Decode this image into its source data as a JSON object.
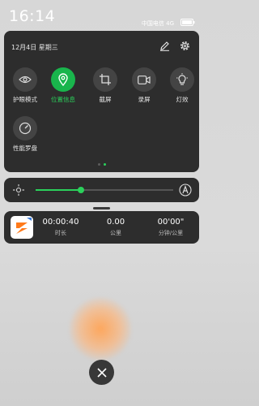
{
  "status_bar": {
    "time": "16:14",
    "carrier": "中国电信 4G",
    "battery_icon": "battery-icon"
  },
  "quick_panel": {
    "date": "12月4日 星期三",
    "edit_icon": "pencil-icon",
    "settings_icon": "gear-icon",
    "tiles": [
      {
        "label": "护眼模式",
        "icon": "eye-icon",
        "active": false
      },
      {
        "label": "位置信息",
        "icon": "location-pin-icon",
        "active": true
      },
      {
        "label": "截屏",
        "icon": "crop-icon",
        "active": false
      },
      {
        "label": "录屏",
        "icon": "video-camera-icon",
        "active": false
      },
      {
        "label": "灯效",
        "icon": "light-bulb-icon",
        "active": false
      },
      {
        "label": "性能罗盘",
        "icon": "gauge-icon",
        "active": false
      }
    ],
    "page_count": 2,
    "current_page": 1
  },
  "brightness": {
    "level_percent": 33,
    "brightness_icon": "brightness-sun-icon",
    "auto_icon": "auto-brightness-icon"
  },
  "notification": {
    "app_icon": "sport-app-icon",
    "stats": [
      {
        "value": "00:00:40",
        "unit": "时长"
      },
      {
        "value": "0.00",
        "unit": "公里"
      },
      {
        "value": "00'00\"",
        "unit": "分钟/公里"
      }
    ]
  },
  "close_icon": "close-icon",
  "colors": {
    "accent": "#19b54c",
    "panel": "#2d2d2d",
    "background": "#d7d7d7"
  }
}
